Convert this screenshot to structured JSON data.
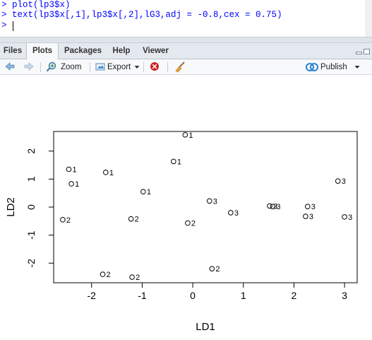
{
  "console": {
    "lines": [
      "> plot(lp3$x)",
      "> text(lp3$x[,1],lp3$x[,2],lG3,adj = -0.8,cex = 0.75)",
      "> "
    ]
  },
  "tabs": [
    {
      "label": "Files",
      "active": false
    },
    {
      "label": "Plots",
      "active": true
    },
    {
      "label": "Packages",
      "active": false
    },
    {
      "label": "Help",
      "active": false
    },
    {
      "label": "Viewer",
      "active": false
    }
  ],
  "toolbar": {
    "zoom_label": "Zoom",
    "export_label": "Export",
    "publish_label": "Publish",
    "icons": [
      "back-arrow-icon",
      "forward-arrow-icon",
      "zoom-magnifier-icon",
      "export-icon",
      "chevron-down-icon",
      "remove-plot-icon",
      "broom-icon",
      "publish-icon",
      "chevron-down-icon"
    ]
  },
  "colors": {
    "console_text": "#0000ff",
    "accent_blue": "#2a84d2",
    "remove_red": "#cc2222"
  },
  "chart_data": {
    "type": "scatter",
    "title": "",
    "xlabel": "LD1",
    "ylabel": "LD2",
    "xlim": [
      -2.75,
      3.25
    ],
    "ylim": [
      -2.7,
      2.7
    ],
    "x_ticks": [
      -2,
      -1,
      0,
      1,
      2,
      3
    ],
    "y_ticks": [
      -2,
      -1,
      0,
      1,
      2
    ],
    "grid": false,
    "points": [
      {
        "x": -0.15,
        "y": 2.58,
        "label": "1"
      },
      {
        "x": -2.45,
        "y": 1.35,
        "label": "1"
      },
      {
        "x": -1.72,
        "y": 1.24,
        "label": "1"
      },
      {
        "x": -0.38,
        "y": 1.63,
        "label": "1"
      },
      {
        "x": -2.4,
        "y": 0.83,
        "label": "1"
      },
      {
        "x": -0.98,
        "y": 0.55,
        "label": "1"
      },
      {
        "x": -2.57,
        "y": -0.45,
        "label": "2"
      },
      {
        "x": -1.22,
        "y": -0.42,
        "label": "2"
      },
      {
        "x": -0.1,
        "y": -0.57,
        "label": "2"
      },
      {
        "x": -1.78,
        "y": -2.4,
        "label": "2"
      },
      {
        "x": -1.2,
        "y": -2.5,
        "label": "2"
      },
      {
        "x": 0.38,
        "y": -2.2,
        "label": "2"
      },
      {
        "x": 0.33,
        "y": 0.22,
        "label": "3"
      },
      {
        "x": 0.75,
        "y": -0.2,
        "label": "3"
      },
      {
        "x": 1.52,
        "y": 0.04,
        "label": "3"
      },
      {
        "x": 1.58,
        "y": 0.02,
        "label": "3"
      },
      {
        "x": 2.27,
        "y": 0.02,
        "label": "3"
      },
      {
        "x": 2.23,
        "y": -0.33,
        "label": "3"
      },
      {
        "x": 2.87,
        "y": 0.93,
        "label": "3"
      },
      {
        "x": 3.0,
        "y": -0.35,
        "label": "3"
      }
    ]
  }
}
